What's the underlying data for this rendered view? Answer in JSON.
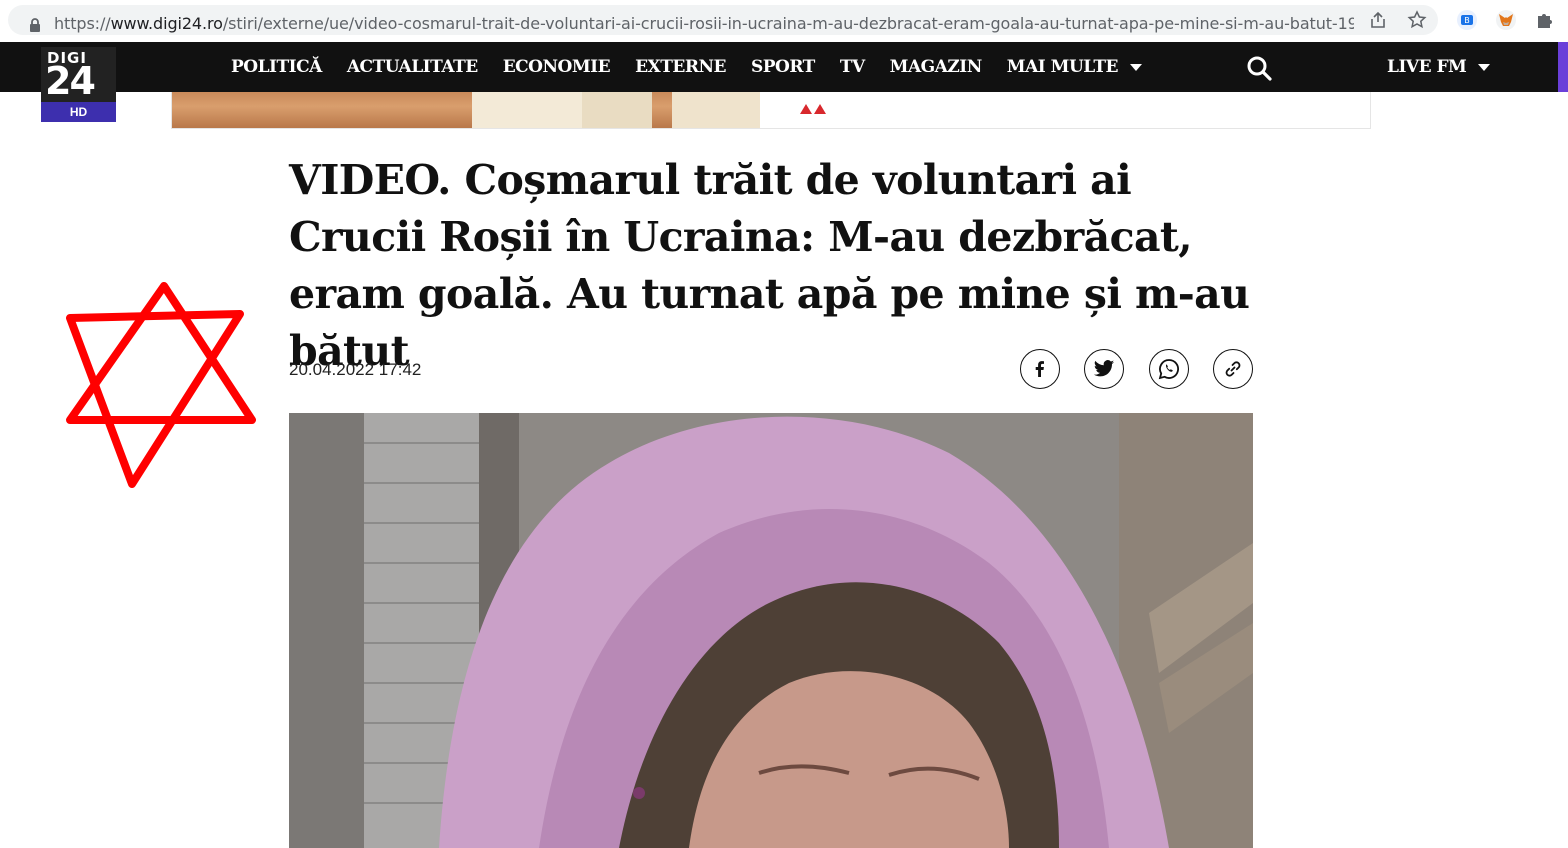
{
  "browser": {
    "url_prefix": "https://",
    "url_host": "www.digi24.ro",
    "url_path": "/stiri/externe/ue/video-cosmarul-trait-de-voluntari-ai-crucii-rosii-in-ucraina-m-au-dezbracat-eram-goala-au-turnat-apa-pe-mine-si-m-au-batut-19..."
  },
  "site": {
    "logo_top": "DIGI",
    "logo_number": "24",
    "logo_hd": "HD",
    "nav": [
      "POLITICĂ",
      "ACTUALITATE",
      "ECONOMIE",
      "EXTERNE",
      "SPORT",
      "TV",
      "MAGAZIN"
    ],
    "nav_more": "MAI MULTE",
    "live": "LIVE FM",
    "accent": "#6a3fd9",
    "nav_bg": "#111111"
  },
  "article": {
    "title": "VIDEO. Coșmarul trăit de voluntari ai Crucii Roșii în Ucraina: M-au dezbrăcat, eram goală. Au turnat apă pe mine și m-au bătut",
    "date": "20.04.2022 17:42"
  },
  "share": [
    "facebook-icon",
    "twitter-icon",
    "whatsapp-icon",
    "link-icon"
  ],
  "overlay": {
    "shape": "star-of-david",
    "color": "#ff0000"
  }
}
